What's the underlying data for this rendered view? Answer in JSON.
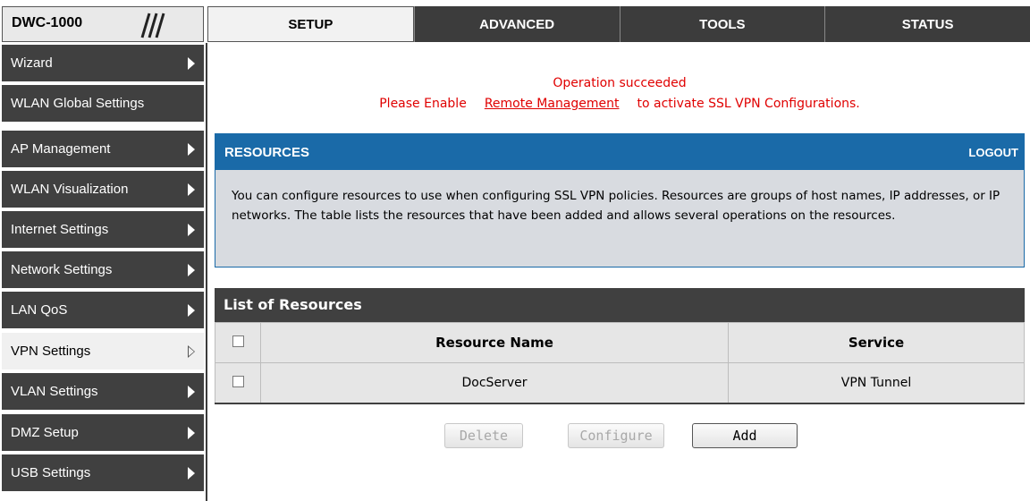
{
  "brand": {
    "logo_text": "DWC-1000"
  },
  "tabs": [
    {
      "label": "SETUP",
      "active": true
    },
    {
      "label": "ADVANCED",
      "active": false
    },
    {
      "label": "TOOLS",
      "active": false
    },
    {
      "label": "STATUS",
      "active": false
    }
  ],
  "sidebar": {
    "items": [
      {
        "label": "Wizard",
        "has_arrow": true,
        "active": false
      },
      {
        "label": "WLAN Global Settings",
        "has_arrow": false,
        "active": false
      },
      {
        "label": "AP Management",
        "has_arrow": true,
        "active": false
      },
      {
        "label": "WLAN Visualization",
        "has_arrow": true,
        "active": false
      },
      {
        "label": "Internet Settings",
        "has_arrow": true,
        "active": false
      },
      {
        "label": "Network Settings",
        "has_arrow": true,
        "active": false
      },
      {
        "label": "LAN QoS",
        "has_arrow": true,
        "active": false
      },
      {
        "label": "VPN Settings",
        "has_arrow": true,
        "active": true
      },
      {
        "label": "VLAN Settings",
        "has_arrow": true,
        "active": false
      },
      {
        "label": "DMZ Setup",
        "has_arrow": true,
        "active": false
      },
      {
        "label": "USB Settings",
        "has_arrow": true,
        "active": false
      }
    ]
  },
  "messages": {
    "success": "Operation succeeded",
    "prefix": "Please Enable",
    "link": "Remote Management",
    "suffix": "to activate SSL VPN Configurations."
  },
  "resources": {
    "title": "RESOURCES",
    "logout": "LOGOUT",
    "description": "You can configure resources to use when configuring SSL VPN policies. Resources are groups of host names, IP addresses, or IP networks. The table lists the resources that have been added and allows several operations on the resources."
  },
  "list": {
    "title": "List of Resources",
    "columns": [
      "Resource Name",
      "Service"
    ],
    "rows": [
      {
        "name": "DocServer",
        "service": "VPN Tunnel"
      }
    ]
  },
  "buttons": {
    "delete": "Delete",
    "configure": "Configure",
    "add": "Add"
  },
  "colors": {
    "header_blue": "#1a6aa8",
    "nav_dark": "#404040",
    "message_red": "#e00000"
  }
}
